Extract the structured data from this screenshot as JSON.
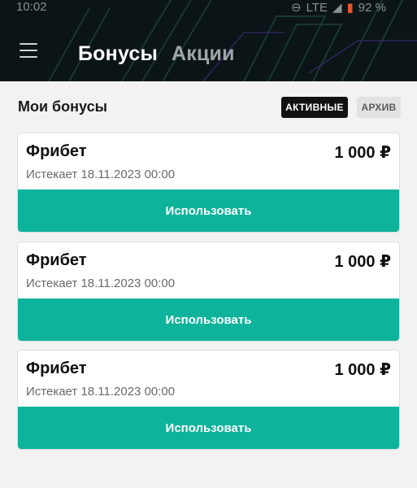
{
  "status_bar": {
    "time": "10:02",
    "network": "LTE",
    "battery": "92 %"
  },
  "header": {
    "tabs": [
      {
        "label": "Бонусы",
        "active": true
      },
      {
        "label": "Акции",
        "active": false
      }
    ]
  },
  "section": {
    "title": "Мои бонусы",
    "filters": [
      {
        "label": "АКТИВНЫЕ",
        "active": true
      },
      {
        "label": "АРХИВ",
        "active": false
      }
    ]
  },
  "bonuses": [
    {
      "title": "Фрибет",
      "amount": "1 000 ₽",
      "expires": "Истекает 18.11.2023 00:00",
      "button": "Использовать"
    },
    {
      "title": "Фрибет",
      "amount": "1 000 ₽",
      "expires": "Истекает 18.11.2023 00:00",
      "button": "Использовать"
    },
    {
      "title": "Фрибет",
      "amount": "1 000 ₽",
      "expires": "Истекает 18.11.2023 00:00",
      "button": "Использовать"
    }
  ],
  "colors": {
    "accent": "#0db39a",
    "header_bg": "#0b1416",
    "page_bg": "#f2f2f2"
  }
}
